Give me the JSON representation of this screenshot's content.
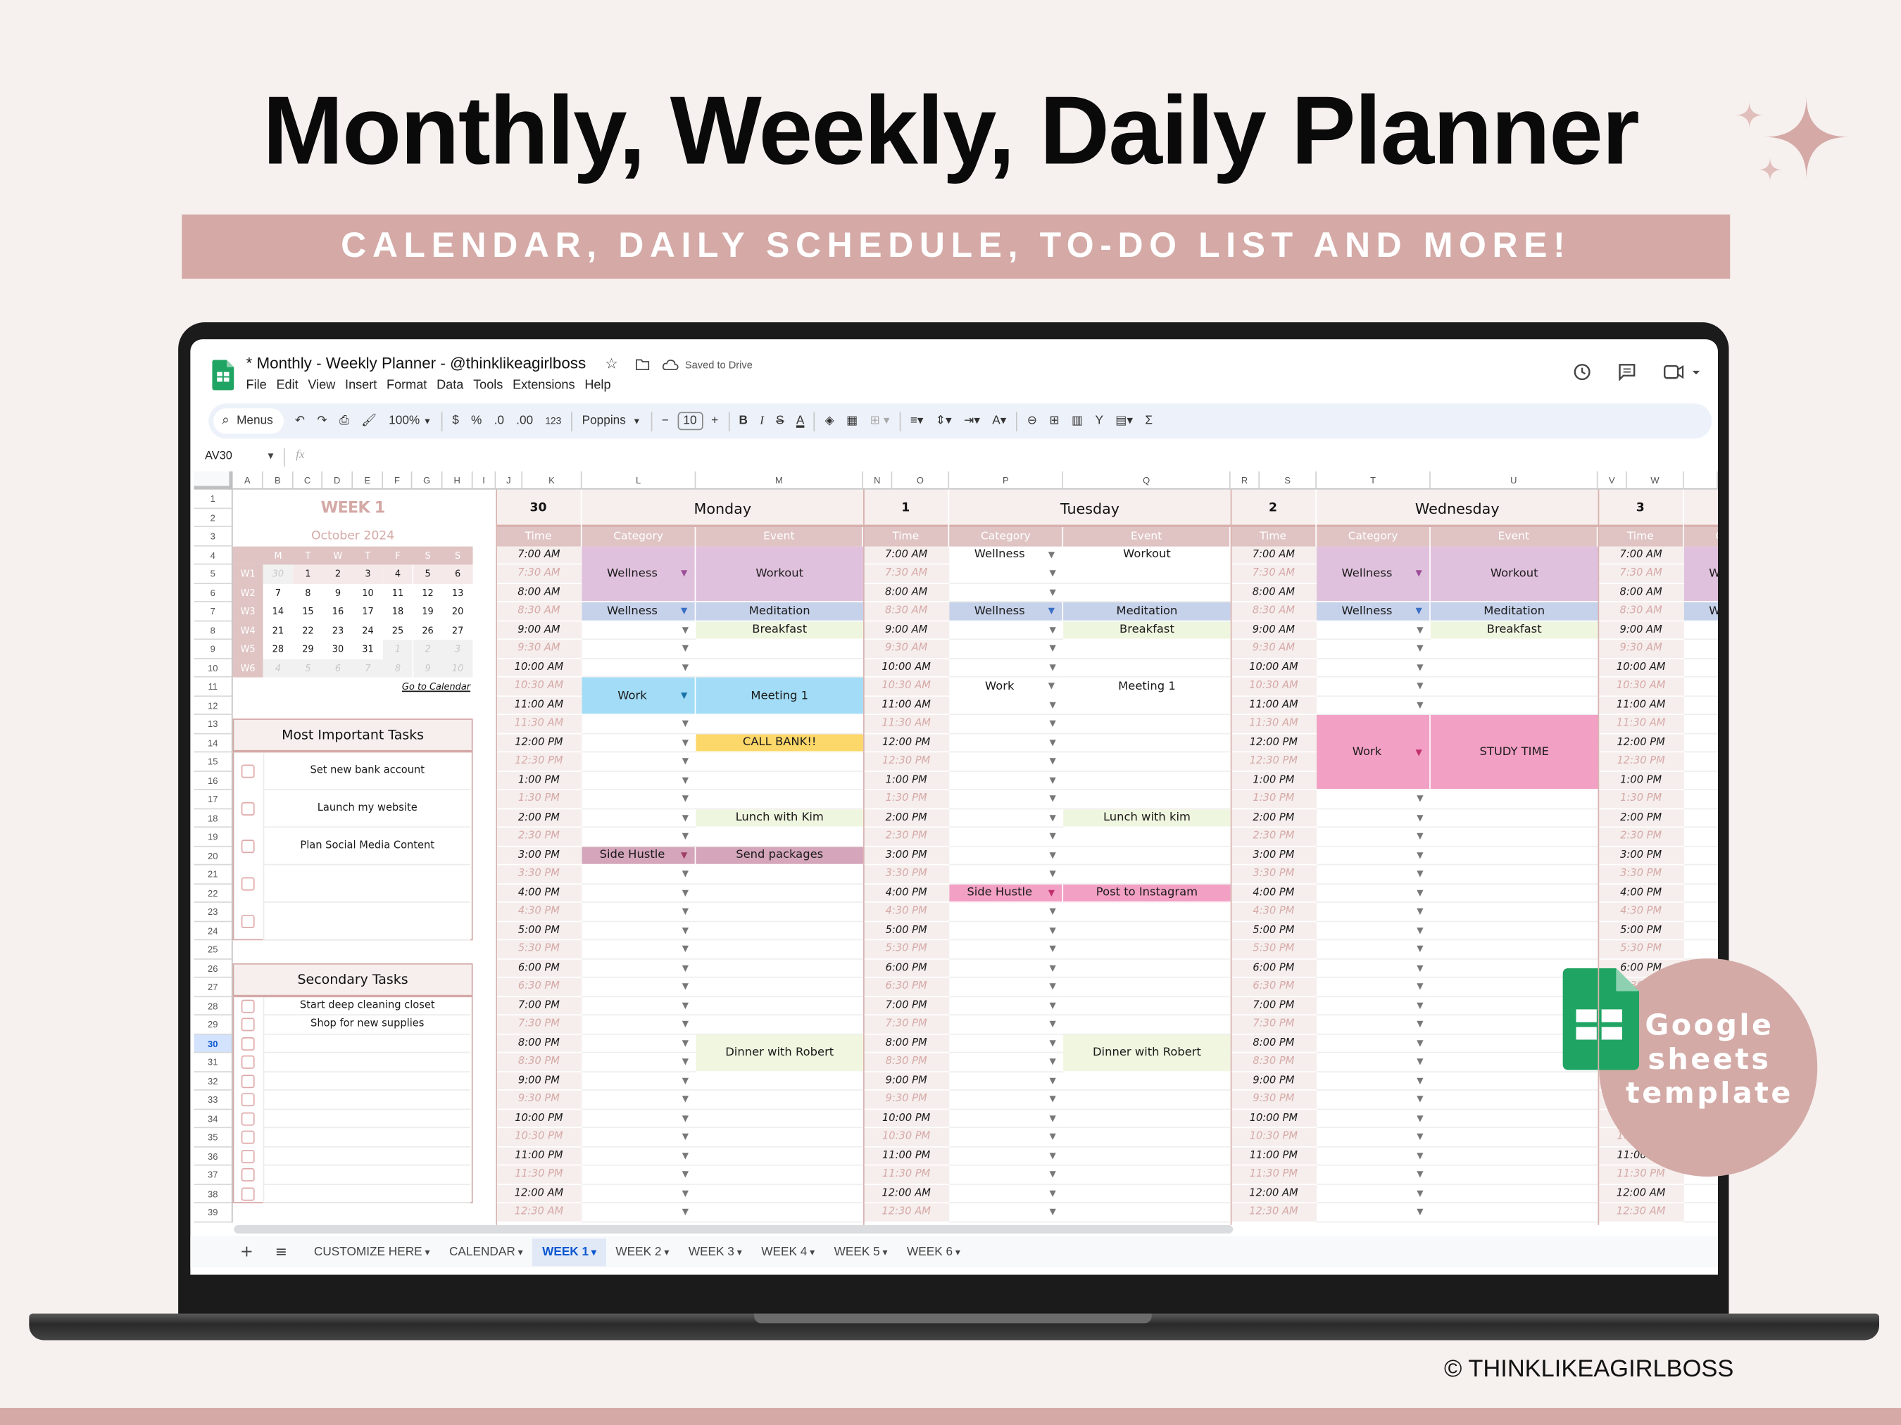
{
  "hero": {
    "title": "Monthly, Weekly, Daily Planner",
    "subtitle": "CALENDAR, DAILY SCHEDULE, TO-DO LIST AND MORE!",
    "accent": "#d4a9a6",
    "copyright": "© THINKLIKEAGIRLBOSS"
  },
  "badge": {
    "lines": [
      "Google",
      "sheets",
      "template"
    ],
    "color": "#d3aaa6",
    "icon": "google-sheets-icon"
  },
  "app": {
    "doc_title": "* Monthly - Weekly Planner - @thinklikeagirlboss",
    "save_status": "Saved to Drive",
    "menus": [
      "File",
      "Edit",
      "View",
      "Insert",
      "Format",
      "Data",
      "Tools",
      "Extensions",
      "Help"
    ],
    "toolbar": {
      "search": "Menus",
      "zoom": "100%",
      "currency": "$",
      "percent": "%",
      "dec_decrease": ".0",
      "dec_increase": ".00",
      "number_format": "123",
      "font": "Poppins",
      "font_size": "10",
      "bold": "B",
      "italic": "I",
      "strike": "S",
      "text_color": "A",
      "sum": "Σ"
    },
    "name_box": "AV30",
    "fx": "fx",
    "columns": [
      "A",
      "B",
      "C",
      "D",
      "E",
      "F",
      "G",
      "H",
      "I",
      "J",
      "K",
      "L",
      "M",
      "N",
      "O",
      "P",
      "Q",
      "R",
      "S",
      "T",
      "U",
      "V",
      "W"
    ],
    "rows": [
      1,
      2,
      3,
      4,
      5,
      6,
      7,
      8,
      9,
      10,
      11,
      12,
      13,
      14,
      15,
      16,
      17,
      18,
      19,
      20,
      21,
      22,
      23,
      24,
      25,
      26,
      27,
      28,
      29,
      30,
      31,
      32,
      33,
      34,
      35,
      36,
      37,
      38,
      39
    ],
    "selected_row": 30,
    "tabs": [
      {
        "label": "CUSTOMIZE HERE"
      },
      {
        "label": "CALENDAR"
      },
      {
        "label": "WEEK 1",
        "active": true
      },
      {
        "label": "WEEK 2"
      },
      {
        "label": "WEEK 3"
      },
      {
        "label": "WEEK 4"
      },
      {
        "label": "WEEK 5"
      },
      {
        "label": "WEEK 6"
      }
    ]
  },
  "sidebar": {
    "week_title": "WEEK 1",
    "month": "October 2024",
    "weekday_headers": [
      "M",
      "T",
      "W",
      "T",
      "F",
      "S",
      "S"
    ],
    "weeks": [
      {
        "label": "W1",
        "days": [
          {
            "d": "30",
            "out": true
          },
          {
            "d": "1"
          },
          {
            "d": "2"
          },
          {
            "d": "3"
          },
          {
            "d": "4"
          },
          {
            "d": "5"
          },
          {
            "d": "6"
          }
        ]
      },
      {
        "label": "W2",
        "days": [
          {
            "d": "7"
          },
          {
            "d": "8"
          },
          {
            "d": "9"
          },
          {
            "d": "10"
          },
          {
            "d": "11"
          },
          {
            "d": "12"
          },
          {
            "d": "13"
          }
        ]
      },
      {
        "label": "W3",
        "days": [
          {
            "d": "14"
          },
          {
            "d": "15"
          },
          {
            "d": "16"
          },
          {
            "d": "17"
          },
          {
            "d": "18"
          },
          {
            "d": "19"
          },
          {
            "d": "20"
          }
        ]
      },
      {
        "label": "W4",
        "days": [
          {
            "d": "21"
          },
          {
            "d": "22"
          },
          {
            "d": "23"
          },
          {
            "d": "24"
          },
          {
            "d": "25"
          },
          {
            "d": "26"
          },
          {
            "d": "27"
          }
        ]
      },
      {
        "label": "W5",
        "days": [
          {
            "d": "28"
          },
          {
            "d": "29"
          },
          {
            "d": "30"
          },
          {
            "d": "31"
          },
          {
            "d": "1",
            "out": true
          },
          {
            "d": "2",
            "out": true
          },
          {
            "d": "3",
            "out": true
          }
        ]
      },
      {
        "label": "W6",
        "days": [
          {
            "d": "4",
            "out": true
          },
          {
            "d": "5",
            "out": true
          },
          {
            "d": "6",
            "out": true
          },
          {
            "d": "7",
            "out": true
          },
          {
            "d": "8",
            "out": true
          },
          {
            "d": "9",
            "out": true
          },
          {
            "d": "10",
            "out": true
          }
        ]
      }
    ],
    "current_week": "W1",
    "calendar_link": "Go to Calendar",
    "important_tasks": {
      "title": "Most Important Tasks",
      "items": [
        {
          "text": "Set new bank account",
          "done": false
        },
        {
          "text": "Launch my website",
          "done": false
        },
        {
          "text": "Plan Social Media Content",
          "done": false
        },
        {
          "text": "",
          "done": false
        },
        {
          "text": "",
          "done": false
        }
      ]
    },
    "secondary_tasks": {
      "title": "Secondary Tasks",
      "items": [
        {
          "text": "Start deep cleaning closet",
          "done": false
        },
        {
          "text": "Shop for new supplies",
          "done": false
        },
        {
          "text": "",
          "done": false
        },
        {
          "text": "",
          "done": false
        },
        {
          "text": "",
          "done": false
        },
        {
          "text": "",
          "done": false
        },
        {
          "text": "",
          "done": false
        },
        {
          "text": "",
          "done": false
        },
        {
          "text": "",
          "done": false
        },
        {
          "text": "",
          "done": false
        },
        {
          "text": "",
          "done": false
        }
      ]
    }
  },
  "schedule": {
    "headers": {
      "time": "Time",
      "category": "Category",
      "event": "Event"
    },
    "times": [
      "7:00 AM",
      "7:30 AM",
      "8:00 AM",
      "8:30 AM",
      "9:00 AM",
      "9:30 AM",
      "10:00 AM",
      "10:30 AM",
      "11:00 AM",
      "11:30 AM",
      "12:00 PM",
      "12:30 PM",
      "1:00 PM",
      "1:30 PM",
      "2:00 PM",
      "2:30 PM",
      "3:00 PM",
      "3:30 PM",
      "4:00 PM",
      "4:30 PM",
      "5:00 PM",
      "5:30 PM",
      "6:00 PM",
      "6:30 PM",
      "7:00 PM",
      "7:30 PM",
      "8:00 PM",
      "8:30 PM",
      "9:00 PM",
      "9:30 PM",
      "10:00 PM",
      "10:30 PM",
      "11:00 PM",
      "11:30 PM",
      "12:00 AM",
      "12:30 AM"
    ],
    "days": [
      {
        "date": "30",
        "name": "Monday",
        "blocks": [
          {
            "time": "7:00 AM",
            "slots": 3,
            "category": "Wellness",
            "event": "Workout",
            "color": "#e0c1dd",
            "arrow": "#9b4f96"
          },
          {
            "time": "8:30 AM",
            "slots": 1,
            "category": "Wellness",
            "event": "Meditation",
            "color": "#c6d1ea",
            "arrow": "#3a6fc4"
          },
          {
            "time": "9:00 AM",
            "slots": 1,
            "category": "",
            "event": "Breakfast",
            "color": "#eff6df"
          },
          {
            "time": "10:30 AM",
            "slots": 2,
            "category": "Work",
            "event": "Meeting 1",
            "color": "#a2dcf6",
            "arrow": "#1a73a8"
          },
          {
            "time": "12:00 PM",
            "slots": 1,
            "category": "",
            "event": "CALL BANK!!",
            "color": "#fcd76a"
          },
          {
            "time": "2:00 PM",
            "slots": 1,
            "category": "",
            "event": "Lunch with Kim",
            "color": "#eff6df"
          },
          {
            "time": "3:00 PM",
            "slots": 1,
            "category": "Side Hustle",
            "event": "Send packages",
            "color": "#d5a6bb",
            "arrow": "#a0406a"
          },
          {
            "time": "8:00 PM",
            "slots": 2,
            "category": "",
            "event": "Dinner with Robert",
            "color": "#f0f6e0"
          }
        ]
      },
      {
        "date": "1",
        "name": "Tuesday",
        "blocks": [
          {
            "time": "7:00 AM",
            "slots": 1,
            "category": "Wellness",
            "event": "Workout",
            "color": null
          },
          {
            "time": "8:30 AM",
            "slots": 1,
            "category": "Wellness",
            "event": "Meditation",
            "color": "#c6d1ea",
            "arrow": "#3a6fc4"
          },
          {
            "time": "9:00 AM",
            "slots": 1,
            "category": "",
            "event": "Breakfast",
            "color": "#eff6df"
          },
          {
            "time": "10:30 AM",
            "slots": 1,
            "category": "Work",
            "event": "Meeting 1",
            "color": null
          },
          {
            "time": "2:00 PM",
            "slots": 1,
            "category": "",
            "event": "Lunch with kim",
            "color": "#eff6df"
          },
          {
            "time": "4:00 PM",
            "slots": 1,
            "category": "Side Hustle",
            "event": "Post to Instagram",
            "color": "#f2a0c4",
            "arrow": "#c0306a"
          },
          {
            "time": "8:00 PM",
            "slots": 2,
            "category": "",
            "event": "Dinner with Robert",
            "color": "#f0f6e0"
          }
        ]
      },
      {
        "date": "2",
        "name": "Wednesday",
        "blocks": [
          {
            "time": "7:00 AM",
            "slots": 3,
            "category": "Wellness",
            "event": "Workout",
            "color": "#e0c1dd",
            "arrow": "#9b4f96"
          },
          {
            "time": "8:30 AM",
            "slots": 1,
            "category": "Wellness",
            "event": "Meditation",
            "color": "#c6d1ea",
            "arrow": "#3a6fc4"
          },
          {
            "time": "9:00 AM",
            "slots": 1,
            "category": "",
            "event": "Breakfast",
            "color": "#eff6df"
          },
          {
            "time": "11:30 AM",
            "slots": 4,
            "category": "Work",
            "event": "STUDY TIME",
            "color": "#f2a0c4",
            "arrow": "#c0306a"
          }
        ]
      },
      {
        "date": "3",
        "name": "",
        "blocks": [
          {
            "time": "7:00 AM",
            "slots": 3,
            "category": "Wellness",
            "event": "",
            "color": "#e0c1dd",
            "arrow": "#9b4f96"
          },
          {
            "time": "8:30 AM",
            "slots": 1,
            "category": "Wellness",
            "event": "",
            "color": "#c6d1ea",
            "arrow": "#3a6fc4"
          }
        ]
      }
    ]
  }
}
